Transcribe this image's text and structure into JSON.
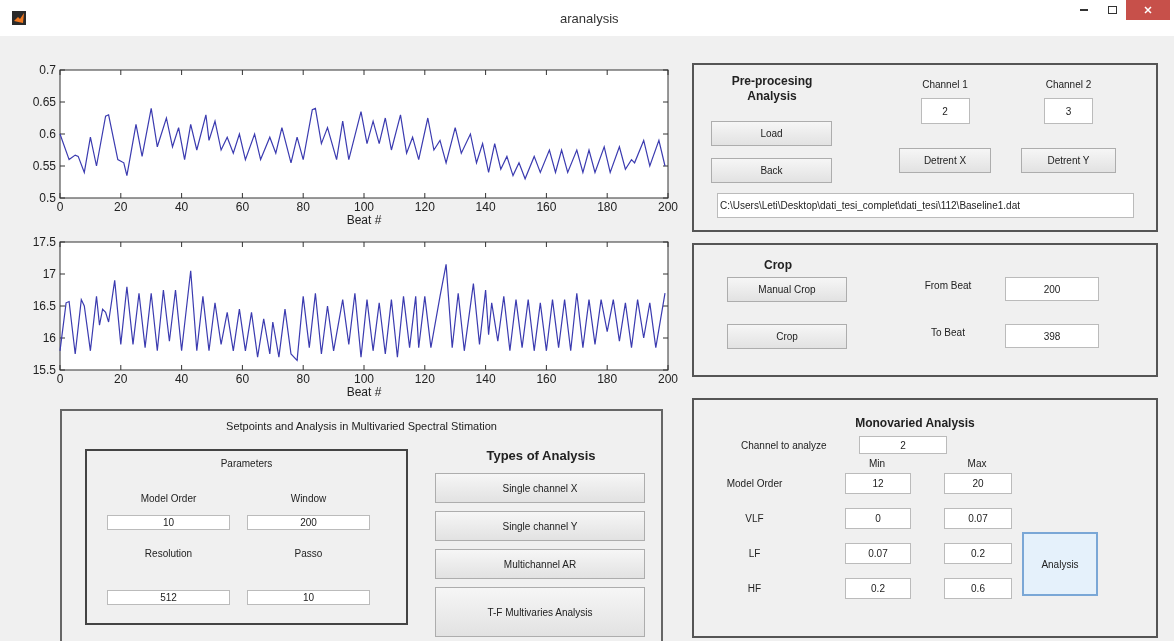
{
  "window": {
    "title": "aranalysis"
  },
  "plots": [
    {
      "chart_data": {
        "type": "line",
        "xlabel": "Beat #",
        "xlim": [
          0,
          200
        ],
        "ylim": [
          0.5,
          0.7
        ],
        "xticks": [
          0,
          20,
          40,
          60,
          80,
          100,
          120,
          140,
          160,
          180,
          200
        ],
        "yticks": [
          0.5,
          0.55,
          0.6,
          0.65,
          0.7
        ],
        "color": "#3b3bb0",
        "x": [
          0,
          3,
          5,
          6,
          8,
          10,
          12,
          15,
          16,
          19,
          21,
          22,
          25,
          27,
          30,
          32,
          35,
          37,
          39,
          41,
          43,
          45,
          48,
          49,
          51,
          53,
          55,
          57,
          59,
          61,
          64,
          66,
          69,
          71,
          73,
          76,
          78,
          80,
          83,
          84,
          86,
          88,
          91,
          93,
          95,
          99,
          101,
          103,
          105,
          107,
          109,
          112,
          114,
          116,
          118,
          121,
          123,
          125,
          127,
          130,
          132,
          135,
          137,
          139,
          141,
          143,
          145,
          147,
          149,
          151,
          153,
          156,
          158,
          161,
          163,
          165,
          167,
          170,
          172,
          174,
          176,
          179,
          181,
          184,
          186,
          188,
          189,
          192,
          194,
          197,
          199
        ],
        "values": [
          0.6,
          0.56,
          0.567,
          0.565,
          0.54,
          0.595,
          0.55,
          0.628,
          0.63,
          0.56,
          0.555,
          0.535,
          0.615,
          0.565,
          0.64,
          0.58,
          0.625,
          0.58,
          0.61,
          0.56,
          0.615,
          0.575,
          0.63,
          0.59,
          0.62,
          0.575,
          0.595,
          0.57,
          0.6,
          0.56,
          0.6,
          0.56,
          0.595,
          0.57,
          0.61,
          0.555,
          0.595,
          0.56,
          0.638,
          0.64,
          0.585,
          0.61,
          0.56,
          0.62,
          0.56,
          0.635,
          0.585,
          0.62,
          0.585,
          0.625,
          0.575,
          0.63,
          0.57,
          0.595,
          0.56,
          0.625,
          0.575,
          0.59,
          0.555,
          0.61,
          0.57,
          0.6,
          0.555,
          0.585,
          0.54,
          0.585,
          0.545,
          0.565,
          0.535,
          0.555,
          0.53,
          0.565,
          0.54,
          0.575,
          0.54,
          0.575,
          0.54,
          0.575,
          0.54,
          0.575,
          0.54,
          0.58,
          0.54,
          0.58,
          0.545,
          0.56,
          0.555,
          0.59,
          0.55,
          0.59,
          0.55
        ]
      }
    },
    {
      "chart_data": {
        "type": "line",
        "xlabel": "Beat #",
        "xlim": [
          0,
          200
        ],
        "ylim": [
          15.5,
          17.5
        ],
        "xticks": [
          0,
          20,
          40,
          60,
          80,
          100,
          120,
          140,
          160,
          180,
          200
        ],
        "yticks": [
          15.5,
          16,
          16.5,
          17,
          17.5
        ],
        "color": "#3b3bb0",
        "x": [
          0,
          2,
          3,
          5,
          7,
          8,
          10,
          12,
          13,
          14,
          15,
          16,
          18,
          20,
          22,
          24,
          26,
          28,
          30,
          32,
          34,
          36,
          38,
          40,
          43,
          45,
          47,
          49,
          51,
          53,
          55,
          57,
          59,
          61,
          63,
          65,
          67,
          69,
          70,
          72,
          74,
          76,
          78,
          80,
          82,
          84,
          86,
          88,
          90,
          93,
          95,
          97,
          99,
          101,
          103,
          105,
          107,
          109,
          111,
          113,
          115,
          117,
          118,
          120,
          122,
          125,
          127,
          129,
          131,
          133,
          136,
          138,
          140,
          141,
          142,
          144,
          146,
          148,
          150,
          152,
          154,
          156,
          158,
          160,
          162,
          164,
          166,
          168,
          170,
          172,
          174,
          176,
          178,
          180,
          182,
          184,
          186,
          188,
          190,
          192,
          194,
          196,
          199
        ],
        "values": [
          15.8,
          16.55,
          16.57,
          15.75,
          16.6,
          16.5,
          15.8,
          16.65,
          16.2,
          16.45,
          16.4,
          16.25,
          16.9,
          15.9,
          16.8,
          15.9,
          16.7,
          15.85,
          16.7,
          15.8,
          16.75,
          15.95,
          16.75,
          15.8,
          17.05,
          15.8,
          16.65,
          15.8,
          16.55,
          15.9,
          16.4,
          15.8,
          16.45,
          15.8,
          16.4,
          15.7,
          16.3,
          15.75,
          16.25,
          15.7,
          16.45,
          15.75,
          15.65,
          16.65,
          15.85,
          16.7,
          15.75,
          16.5,
          15.8,
          16.6,
          15.9,
          16.7,
          15.7,
          16.6,
          15.8,
          16.55,
          15.75,
          16.6,
          15.7,
          16.65,
          15.85,
          16.65,
          15.85,
          16.65,
          15.85,
          16.65,
          17.15,
          15.85,
          16.7,
          15.8,
          16.85,
          15.9,
          16.75,
          16.05,
          16.55,
          15.95,
          16.65,
          15.8,
          16.6,
          15.85,
          16.6,
          15.8,
          16.55,
          15.8,
          16.6,
          15.85,
          16.6,
          15.8,
          16.7,
          15.85,
          16.6,
          15.9,
          16.6,
          16.1,
          16.6,
          15.95,
          16.55,
          15.85,
          16.6,
          16.0,
          16.55,
          15.85,
          16.7
        ]
      }
    }
  ],
  "preprocessing": {
    "title": "Pre-procesing Analysis",
    "buttons": [
      "Load",
      "Back"
    ],
    "channels": [
      {
        "label": "Channel 1",
        "value": "2",
        "button": "Detrent X"
      },
      {
        "label": "Channel 2",
        "value": "3",
        "button": "Detrent Y"
      }
    ],
    "path": "C:\\Users\\Leti\\Desktop\\dati_tesi_complet\\dati_tesi\\112\\Baseline1.dat"
  },
  "crop": {
    "title": "Crop",
    "rows": [
      {
        "button": "Manual Crop",
        "label": "From Beat",
        "value": "200"
      },
      {
        "button": "Crop",
        "label": "To Beat",
        "value": "398"
      }
    ]
  },
  "setpoints": {
    "title": "Setpoints and Analysis in Multivaried Spectral Stimation",
    "parameters": {
      "title": "Parameters",
      "fields": [
        {
          "label": "Model Order",
          "value": "10"
        },
        {
          "label": "Window",
          "value": "200"
        },
        {
          "label": "Resolution",
          "value": "512"
        },
        {
          "label": "Passo",
          "value": "10"
        }
      ]
    },
    "types": {
      "title": "Types of Analysis",
      "buttons": [
        "Single channel X",
        "Single channel Y",
        "Multichannel AR",
        "T-F Multivaries Analysis"
      ]
    }
  },
  "monovaried": {
    "title": "Monovaried Analysis",
    "channel": {
      "label": "Channel to analyze",
      "value": "2"
    },
    "columns": [
      "Min",
      "Max"
    ],
    "rows": [
      {
        "label": "Model Order",
        "min": "12",
        "max": "20"
      },
      {
        "label": "VLF",
        "min": "0",
        "max": "0.07"
      },
      {
        "label": "LF",
        "min": "0.07",
        "max": "0.2"
      },
      {
        "label": "HF",
        "min": "0.2",
        "max": "0.6"
      }
    ],
    "button": {
      "label": "Analysis",
      "focused": true
    }
  }
}
